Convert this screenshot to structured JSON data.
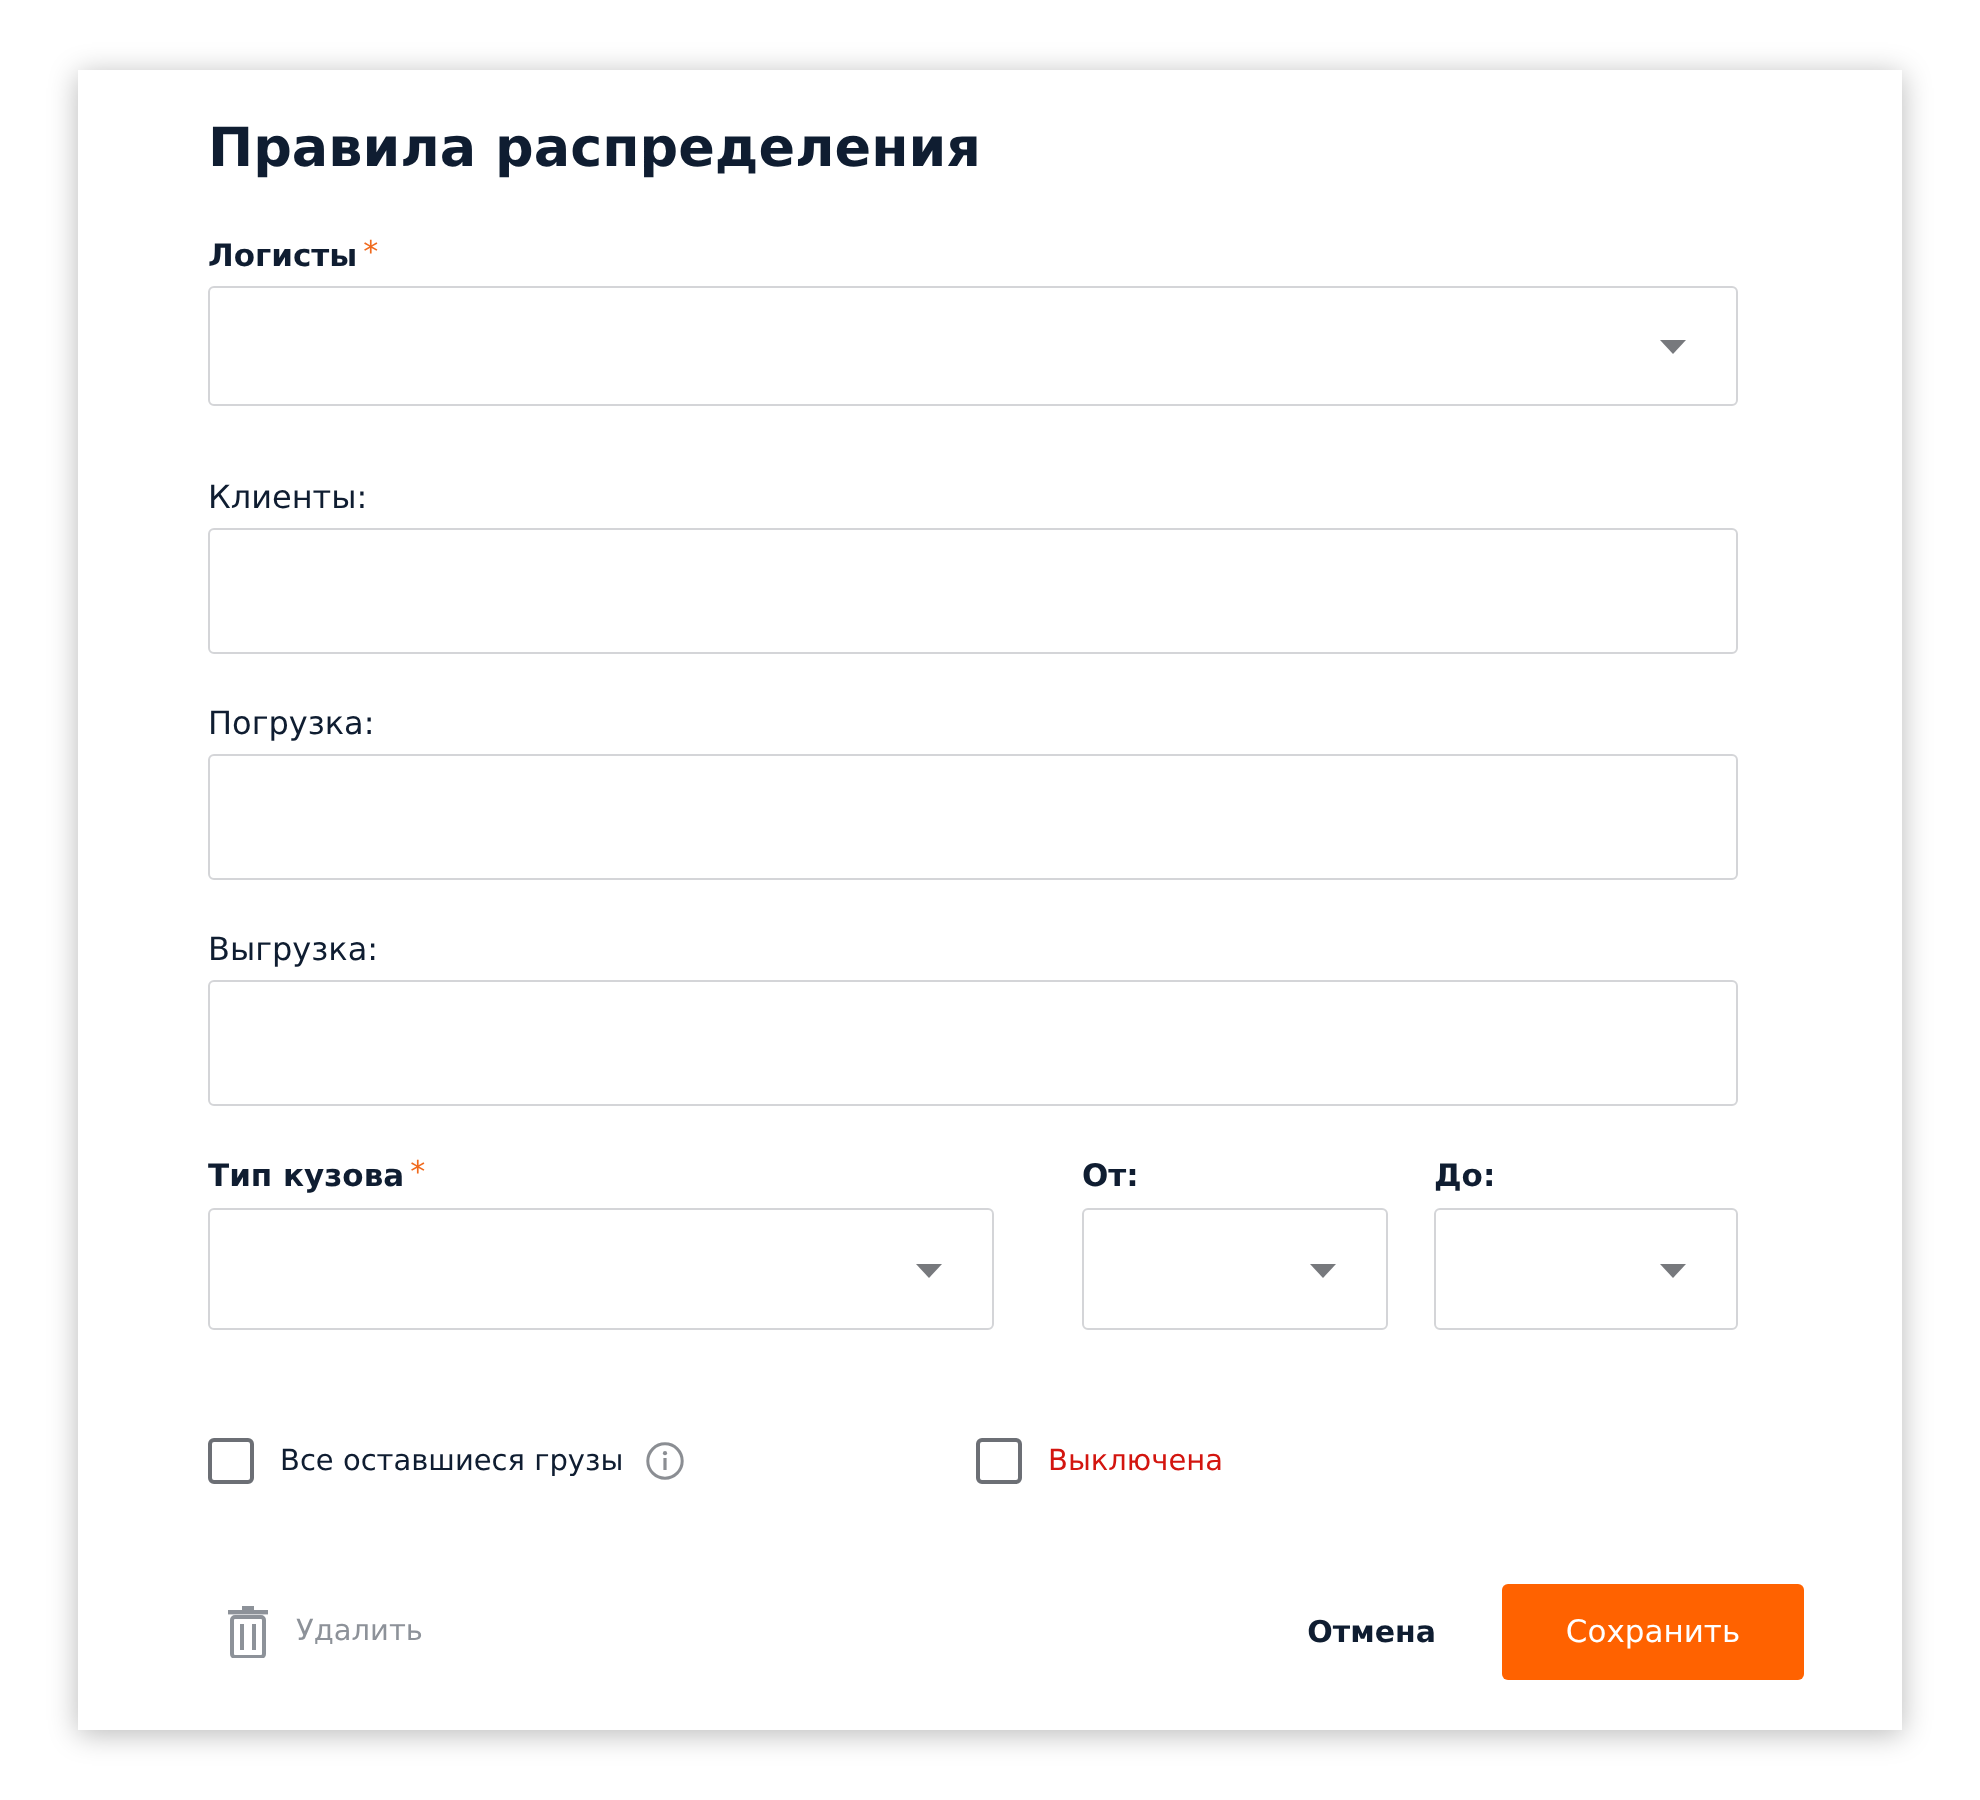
{
  "dialog": {
    "title": "Правила распределения"
  },
  "fields": [
    {
      "kind": "select",
      "label": "Логисты",
      "required_mark": "*"
    },
    {
      "kind": "text",
      "label": "Клиенты:"
    },
    {
      "kind": "text",
      "label": "Погрузка:"
    },
    {
      "kind": "text",
      "label": "Выгрузка:"
    }
  ],
  "inline_fields": [
    {
      "kind": "select",
      "label": "Тип кузова",
      "required_mark": "*"
    },
    {
      "kind": "select",
      "label": "От:"
    },
    {
      "kind": "select",
      "label": "До:"
    }
  ],
  "checks": [
    {
      "kind": "normal",
      "label": "Все оставшиеся грузы",
      "checked": false,
      "info": true
    },
    {
      "kind": "alert",
      "label": "Выключена",
      "checked": false
    }
  ],
  "footer": {
    "delete": {
      "label": "Удалить",
      "disabled": true
    },
    "cancel": {
      "label": "Отмена"
    },
    "save": {
      "label": "Сохранить"
    }
  }
}
